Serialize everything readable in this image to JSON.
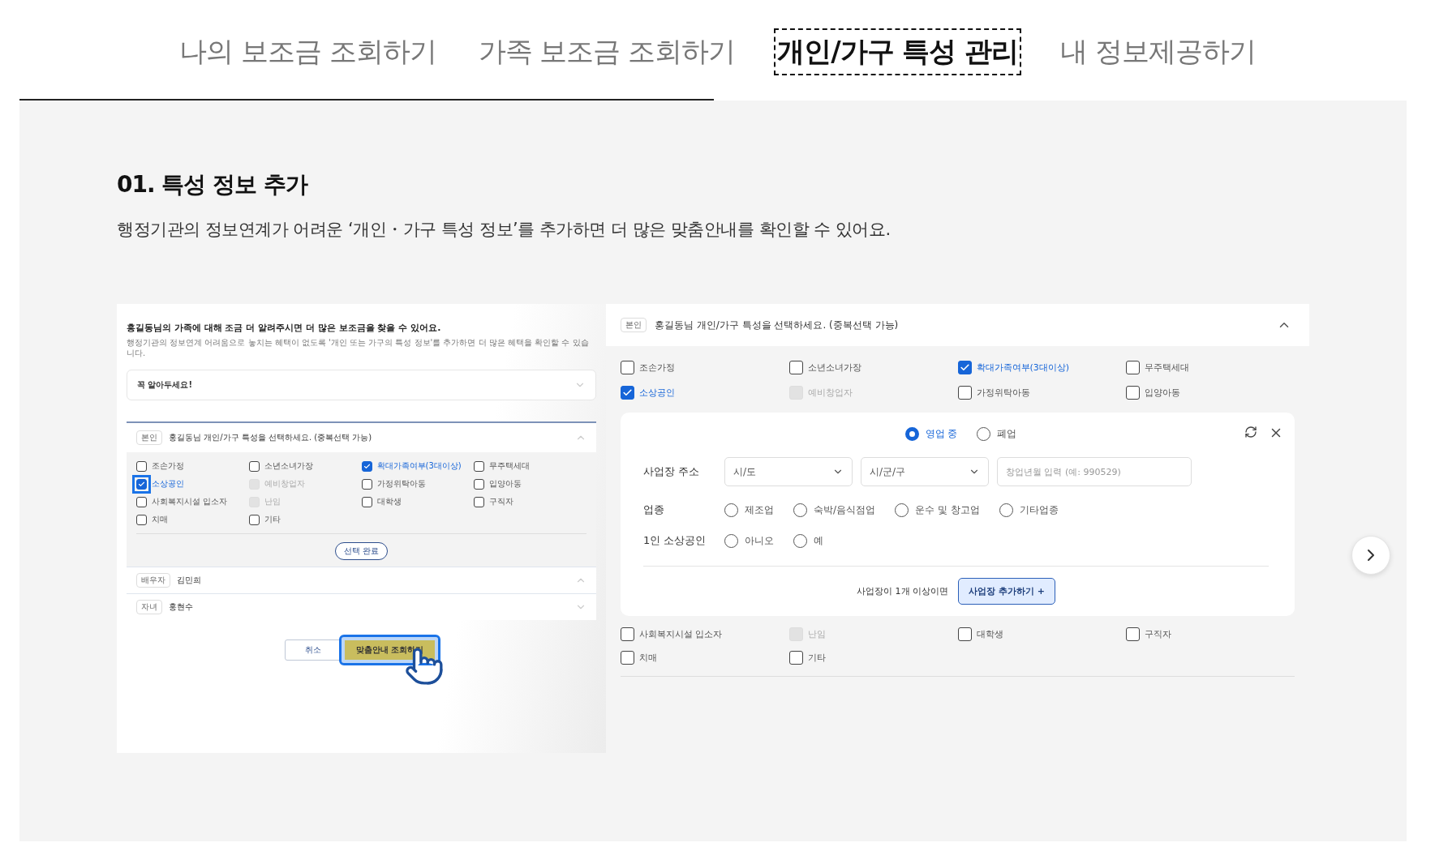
{
  "tabs": [
    {
      "label": "나의 보조금 조회하기",
      "selected": false
    },
    {
      "label": "가족 보조금 조회하기",
      "selected": false
    },
    {
      "label": "개인/가구 특성 관리",
      "selected": true
    },
    {
      "label": "내 정보제공하기",
      "selected": false
    }
  ],
  "section": {
    "title": "01. 특성 정보 추가",
    "description": "행정기관의 정보연계가 어려운 ‘개인・가구 특성 정보’를 추가하면 더 많은 맞춤안내를 확인할 수 있어요."
  },
  "preview_left": {
    "heading": "홍길동님의 가족에 대해 조금 더 알려주시면 더 많은 보조금을 찾을 수 있어요.",
    "subtext": "행정기관의 정보연계 어려움으로 놓치는 혜택이 없도록 '개인 또는 가구의 특성 정보'를 추가하면 더 많은 혜택을 확인할 수 있습니다.",
    "notice": {
      "label": "꼭 알아두세요!",
      "expanded": false
    },
    "self": {
      "tag": "본인",
      "title": "홍길동님 개인/가구 특성을 선택하세요. (중복선택 가능)",
      "expanded": true
    },
    "options": [
      {
        "label": "조손가정",
        "checked": false,
        "disabled": false,
        "focused": false
      },
      {
        "label": "소년소녀가장",
        "checked": false,
        "disabled": false,
        "focused": false
      },
      {
        "label": "확대가족여부(3대이상)",
        "checked": true,
        "disabled": false,
        "focused": false
      },
      {
        "label": "무주택세대",
        "checked": false,
        "disabled": false,
        "focused": false
      },
      {
        "label": "소상공인",
        "checked": true,
        "disabled": false,
        "focused": true
      },
      {
        "label": "예비창업자",
        "checked": false,
        "disabled": true,
        "focused": false
      },
      {
        "label": "가정위탁아동",
        "checked": false,
        "disabled": false,
        "focused": false
      },
      {
        "label": "입양아동",
        "checked": false,
        "disabled": false,
        "focused": false
      },
      {
        "label": "사회복지시설 입소자",
        "checked": false,
        "disabled": false,
        "focused": false
      },
      {
        "label": "난임",
        "checked": false,
        "disabled": true,
        "focused": false
      },
      {
        "label": "대학생",
        "checked": false,
        "disabled": false,
        "focused": false
      },
      {
        "label": "구직자",
        "checked": false,
        "disabled": false,
        "focused": false
      },
      {
        "label": "치매",
        "checked": false,
        "disabled": false,
        "focused": false
      },
      {
        "label": "기타",
        "checked": false,
        "disabled": false,
        "focused": false
      }
    ],
    "done_button": "선택 완료",
    "members": [
      {
        "tag": "배우자",
        "name": "김민희",
        "expanded": true
      },
      {
        "tag": "자녀",
        "name": "홍현수",
        "expanded": false
      }
    ],
    "cancel_button": "취소",
    "submit_button": "맞춤안내 조회하기"
  },
  "preview_right": {
    "tag": "본인",
    "title": "홍길동님 개인/가구 특성을 선택하세요. (중복선택 가능)",
    "expanded": true,
    "options_top": [
      {
        "label": "조손가정",
        "checked": false,
        "disabled": false
      },
      {
        "label": "소년소녀가장",
        "checked": false,
        "disabled": false
      },
      {
        "label": "확대가족여부(3대이상)",
        "checked": true,
        "disabled": false
      },
      {
        "label": "무주택세대",
        "checked": false,
        "disabled": false
      },
      {
        "label": "소상공인",
        "checked": true,
        "disabled": false
      },
      {
        "label": "예비창업자",
        "checked": false,
        "disabled": true
      },
      {
        "label": "가정위탁아동",
        "checked": false,
        "disabled": false
      },
      {
        "label": "입양아동",
        "checked": false,
        "disabled": false
      }
    ],
    "status": [
      {
        "label": "영업 중",
        "selected": true
      },
      {
        "label": "폐업",
        "selected": false
      }
    ],
    "address": {
      "label": "사업장 주소",
      "province": "시/도",
      "city": "시/군/구",
      "date_placeholder": "창업년월 입력 (예: 990529)"
    },
    "industry": {
      "label": "업종",
      "options": [
        {
          "label": "제조업",
          "selected": false
        },
        {
          "label": "숙박/음식점업",
          "selected": false
        },
        {
          "label": "운수 및 창고업",
          "selected": false
        },
        {
          "label": "기타업종",
          "selected": false
        }
      ]
    },
    "one_person": {
      "label": "1인 소상공인",
      "options": [
        {
          "label": "아니오",
          "selected": false
        },
        {
          "label": "예",
          "selected": false
        }
      ]
    },
    "add_hint": "사업장이 1개 이상이면",
    "add_button": "사업장 추가하기 +",
    "options_bottom": [
      {
        "label": "사회복지시설 입소자",
        "checked": false,
        "disabled": false
      },
      {
        "label": "난임",
        "checked": false,
        "disabled": true
      },
      {
        "label": "대학생",
        "checked": false,
        "disabled": false
      },
      {
        "label": "구직자",
        "checked": false,
        "disabled": false
      },
      {
        "label": "치매",
        "checked": false,
        "disabled": false
      },
      {
        "label": "기타",
        "checked": false,
        "disabled": false
      }
    ]
  }
}
